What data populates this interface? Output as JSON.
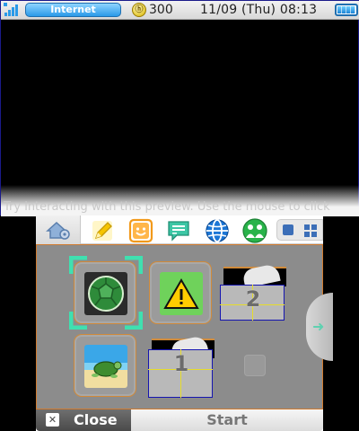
{
  "status_bar": {
    "connection_label": "Internet",
    "coin_symbol": "ⓗ",
    "play_coins": "300",
    "datetime": "11/09 (Thu) 08:13",
    "icons": [
      "wifi-signal-icon",
      "play-coin-icon",
      "battery-icon"
    ],
    "accent": "#2a9ae8",
    "battery_level": 1.0
  },
  "preview": {
    "hint_text": "Try interacting with this preview. Use the mouse to click"
  },
  "toolbar": {
    "icons": [
      "settings-house-icon",
      "pencil-icon",
      "smiley-icon",
      "speech-bubble-icon",
      "globe-icon",
      "friends-icon",
      "small-tiles-view-icon",
      "large-tiles-view-icon"
    ]
  },
  "grid": {
    "tiles": [
      {
        "name": "turtle-shell-app",
        "icon": "turtle-shell-icon",
        "selected": true
      },
      {
        "name": "warning-app",
        "icon": "warning-triangle-icon",
        "selected": false
      },
      {
        "name": "folder-2",
        "icon": "folder-icon",
        "label": "2"
      },
      {
        "name": "turtle-beach-app",
        "icon": "turtle-beach-icon",
        "selected": false
      },
      {
        "name": "folder-1",
        "icon": "folder-icon",
        "label": "1"
      }
    ],
    "selection_color": "#3fe0b0",
    "tile_border_color": "#d08a3a"
  },
  "bottom_bar": {
    "close_icon_glyph": "✕",
    "close_label": "Close",
    "start_label": "Start"
  }
}
